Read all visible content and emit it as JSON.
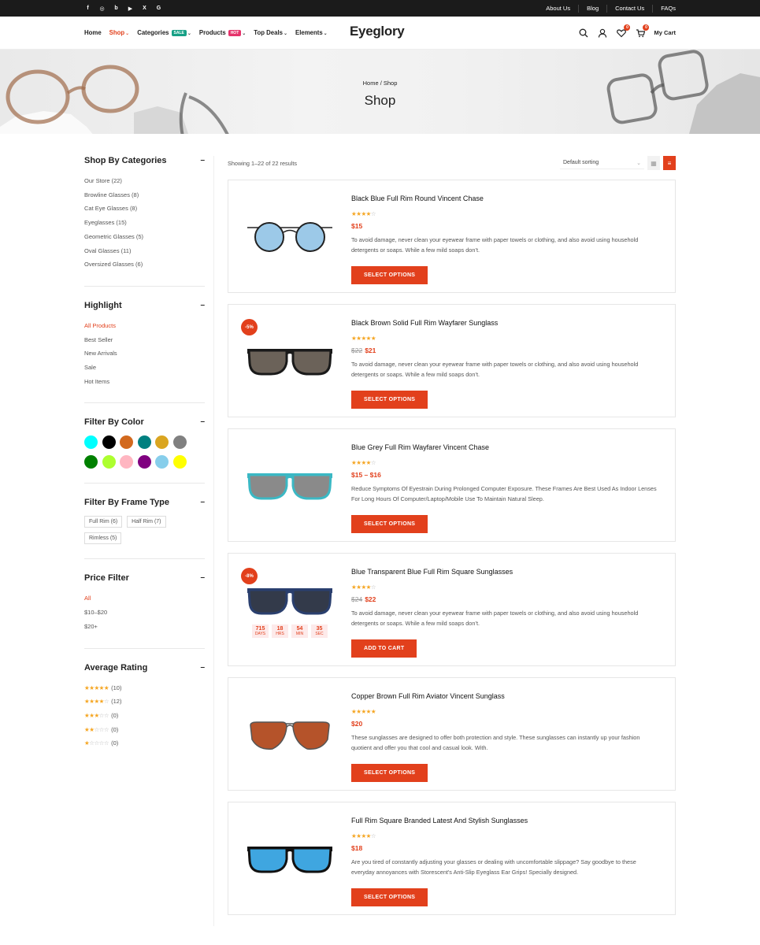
{
  "topbar": {
    "social": [
      "facebook-icon",
      "instagram-icon",
      "behance-icon",
      "youtube-icon",
      "x-icon",
      "google-icon"
    ],
    "links": [
      "About Us",
      "Blog",
      "Contact Us",
      "FAQs"
    ]
  },
  "header": {
    "logo": "Eyeglory",
    "nav": [
      {
        "label": "Home",
        "active": false
      },
      {
        "label": "Shop",
        "active": true,
        "chev": true
      },
      {
        "label": "Categories",
        "badge": "SALE",
        "badge_color": "#16a085",
        "chev": true
      },
      {
        "label": "Products",
        "badge": "HOT",
        "badge_color": "#e5336b",
        "chev": true
      },
      {
        "label": "Top Deals",
        "chev": true
      },
      {
        "label": "Elements",
        "chev": true
      }
    ],
    "wishlist_count": "0",
    "cart_count": "0",
    "cart_label": "My Cart"
  },
  "banner": {
    "breadcrumb": "Home / Shop",
    "title": "Shop"
  },
  "sidebar": {
    "categories": {
      "title": "Shop By Categories",
      "items": [
        "Our Store (22)",
        "Browline Glasses (8)",
        "Cat Eye Glasses (8)",
        "Eyeglasses (15)",
        "Geometric Glasses (5)",
        "Oval Glasses (11)",
        "Oversized Glasses (6)"
      ]
    },
    "highlight": {
      "title": "Highlight",
      "items": [
        "All Products",
        "Best Seller",
        "New Arrivals",
        "Sale",
        "Hot Items"
      ]
    },
    "color": {
      "title": "Filter By Color",
      "swatches": [
        "#00ffff",
        "#000000",
        "#d2691e",
        "#008080",
        "#daa520",
        "#808080",
        "#008000",
        "#adff2f",
        "#ffb6c1",
        "#800080",
        "#87ceeb",
        "#ffff00"
      ]
    },
    "frame": {
      "title": "Filter By Frame Type",
      "items": [
        "Full Rim (6)",
        "Half Rim (7)",
        "Rimless (5)"
      ]
    },
    "price": {
      "title": "Price Filter",
      "items": [
        "All",
        "$10–$20",
        "$20+"
      ]
    },
    "rating": {
      "title": "Average Rating",
      "items": [
        {
          "stars": 5,
          "count": "(10)"
        },
        {
          "stars": 4,
          "count": "(12)"
        },
        {
          "stars": 3,
          "count": "(0)"
        },
        {
          "stars": 2,
          "count": "(0)"
        },
        {
          "stars": 1,
          "count": "(0)"
        }
      ]
    }
  },
  "toolbar": {
    "results": "Showing 1–22 of 22 results",
    "sort": "Default sorting"
  },
  "products": [
    {
      "title": "Black Blue Full Rim Round Vincent Chase",
      "rating": 4,
      "price": "$15",
      "old": "",
      "discount": "",
      "desc": "To avoid damage, never clean your eyewear frame with paper towels or clothing, and also avoid using household detergents or soaps. While a few mild soaps don’t.",
      "button": "SELECT OPTIONS",
      "lens": "#9cc9e8",
      "frame": "#222",
      "shape": "round"
    },
    {
      "title": "Black Brown Solid Full Rim Wayfarer Sunglass",
      "rating": 5,
      "price": "$21",
      "old": "$22",
      "discount": "-5%",
      "desc": "To avoid damage, never clean your eyewear frame with paper towels or clothing, and also avoid using household detergents or soaps. While a few mild soaps don’t.",
      "button": "SELECT OPTIONS",
      "lens": "#6b6259",
      "frame": "#1a1a1a",
      "shape": "square"
    },
    {
      "title": "Blue Grey Full Rim Wayfarer Vincent Chase",
      "rating": 4,
      "price": "$15 – $16",
      "old": "",
      "discount": "",
      "desc": "Reduce Symptoms Of Eyestrain During Prolonged Computer Exposure. These Frames Are Best Used As Indoor Lenses For Long Hours Of Computer/Laptop/Mobile Use To Maintain Natural Sleep.",
      "button": "SELECT OPTIONS",
      "lens": "#8a8a8a",
      "frame": "#3bb8c4",
      "shape": "square"
    },
    {
      "title": "Blue Transparent Blue Full Rim Square Sunglasses",
      "rating": 4,
      "price": "$22",
      "old": "$24",
      "discount": "-8%",
      "desc": "To avoid damage, never clean your eyewear frame with paper towels or clothing, and also avoid using household detergents or soaps. While a few mild soaps don’t.",
      "button": "ADD TO CART",
      "lens": "#333a4a",
      "frame": "#2a3f6e",
      "shape": "square",
      "countdown": [
        {
          "v": "715",
          "l": "DAYS"
        },
        {
          "v": "18",
          "l": "HRS"
        },
        {
          "v": "54",
          "l": "MIN"
        },
        {
          "v": "35",
          "l": "SEC"
        }
      ]
    },
    {
      "title": "Copper Brown Full Rim Aviator Vincent Sunglass",
      "rating": 5,
      "price": "$20",
      "old": "",
      "discount": "",
      "desc": "These sunglasses are designed to offer both protection and style. These sunglasses can instantly up your fashion quotient and offer you that cool and casual look. With.",
      "button": "SELECT OPTIONS",
      "lens": "#b5532a",
      "frame": "#555",
      "shape": "aviator"
    },
    {
      "title": "Full Rim Square Branded Latest And Stylish Sunglasses",
      "rating": 4,
      "price": "$18",
      "old": "",
      "discount": "",
      "desc": "Are you tired of constantly adjusting your glasses or dealing with uncomfortable slippage? Say goodbye to these everyday annoyances with Storescent's Anti-Slip Eyeglass Ear Grips! Specially designed.",
      "button": "SELECT OPTIONS",
      "lens": "#3fa6e0",
      "frame": "#111",
      "shape": "square"
    }
  ]
}
